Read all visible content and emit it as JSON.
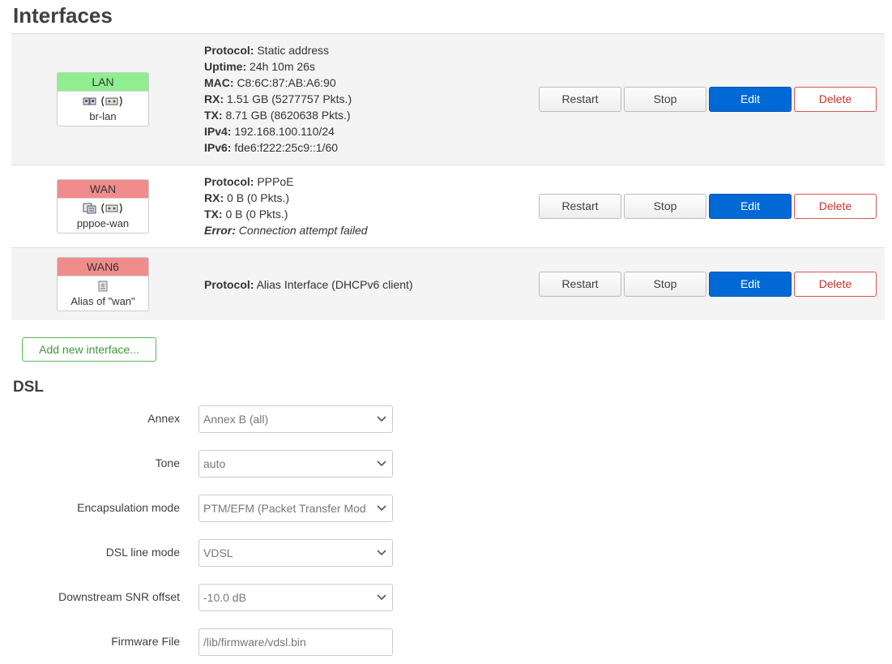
{
  "page": {
    "title": "Interfaces"
  },
  "interfaces": [
    {
      "name": "LAN",
      "device": "br-lan",
      "status_color": "#90ee90",
      "icons": [
        "ethernet-ports-icon",
        "wireless-icon"
      ],
      "info": [
        {
          "key": "Protocol:",
          "value": "Static address"
        },
        {
          "key": "Uptime:",
          "value": "24h 10m 26s"
        },
        {
          "key": "MAC:",
          "value": "C8:6C:87:AB:A6:90"
        },
        {
          "key": "RX:",
          "value": "1.51 GB (5277757 Pkts.)"
        },
        {
          "key": "TX:",
          "value": "8.71 GB (8620638 Pkts.)"
        },
        {
          "key": "IPv4:",
          "value": "192.168.100.110/24"
        },
        {
          "key": "IPv6:",
          "value": "fde6:f222:25c9::1/60"
        }
      ]
    },
    {
      "name": "WAN",
      "device": "pppoe-wan",
      "status_color": "#f08c8c",
      "icons": [
        "pppoe-device-icon",
        "wireless-icon"
      ],
      "info": [
        {
          "key": "Protocol:",
          "value": "PPPoE"
        },
        {
          "key": "RX:",
          "value": "0 B (0 Pkts.)"
        },
        {
          "key": "TX:",
          "value": "0 B (0 Pkts.)"
        },
        {
          "key": "Error:",
          "value": "Connection attempt failed"
        }
      ]
    },
    {
      "name": "WAN6",
      "device": "Alias of \"wan\"",
      "status_color": "#f08c8c",
      "icons": [
        "alias-interface-icon"
      ],
      "info": [
        {
          "key": "Protocol:",
          "value": "Alias Interface (DHCPv6 client)"
        }
      ]
    }
  ],
  "row_buttons": {
    "restart": "Restart",
    "stop": "Stop",
    "edit": "Edit",
    "delete": "Delete"
  },
  "add_interface_label": "Add new interface...",
  "dsl": {
    "title": "DSL",
    "fields": {
      "annex": {
        "label": "Annex",
        "value": "Annex B (all)"
      },
      "tone": {
        "label": "Tone",
        "value": "auto"
      },
      "encapsulation": {
        "label": "Encapsulation mode",
        "value": "PTM/EFM (Packet Transfer Mod"
      },
      "line_mode": {
        "label": "DSL line mode",
        "value": "VDSL"
      },
      "snr_offset": {
        "label": "Downstream SNR offset",
        "value": "-10.0 dB"
      },
      "firmware": {
        "label": "Firmware File",
        "placeholder": "/lib/firmware/vdsl.bin"
      }
    }
  },
  "colors": {
    "edit_button": "#0069d6",
    "delete_border": "#d9534f",
    "add_button": "#5cb85c"
  }
}
